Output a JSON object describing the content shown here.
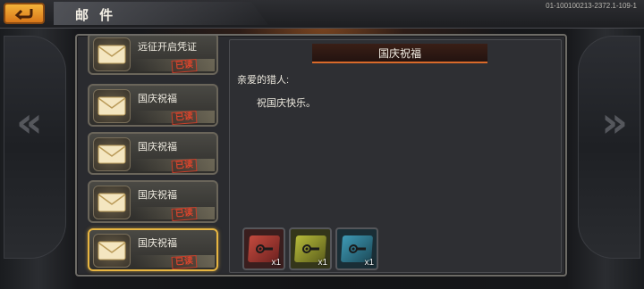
{
  "header": {
    "title": "邮 件",
    "version_code": "01-100100213-2372.1-109-1"
  },
  "mail_list": {
    "items": [
      {
        "title": "远征开启凭证",
        "stamp": "已读",
        "selected": false
      },
      {
        "title": "国庆祝福",
        "stamp": "已读",
        "selected": false
      },
      {
        "title": "国庆祝福",
        "stamp": "已读",
        "selected": false
      },
      {
        "title": "国庆祝福",
        "stamp": "已读",
        "selected": false
      },
      {
        "title": "国庆祝福",
        "stamp": "已读",
        "selected": true
      }
    ]
  },
  "detail": {
    "title": "国庆祝福",
    "greeting": "亲爱的猎人:",
    "body": "祝国庆快乐。",
    "attachments": [
      {
        "quantity": "x1",
        "color": "#b8403a",
        "icon": "wrench-gear-icon"
      },
      {
        "quantity": "x1",
        "color": "#a4a832",
        "icon": "wrench-gear-icon"
      },
      {
        "quantity": "x1",
        "color": "#3a8aa4",
        "icon": "wrench-gear-icon"
      }
    ]
  },
  "colors": {
    "accent": "#e7b541",
    "stamp": "#d9452d",
    "header_underline": "#d96a2a"
  }
}
